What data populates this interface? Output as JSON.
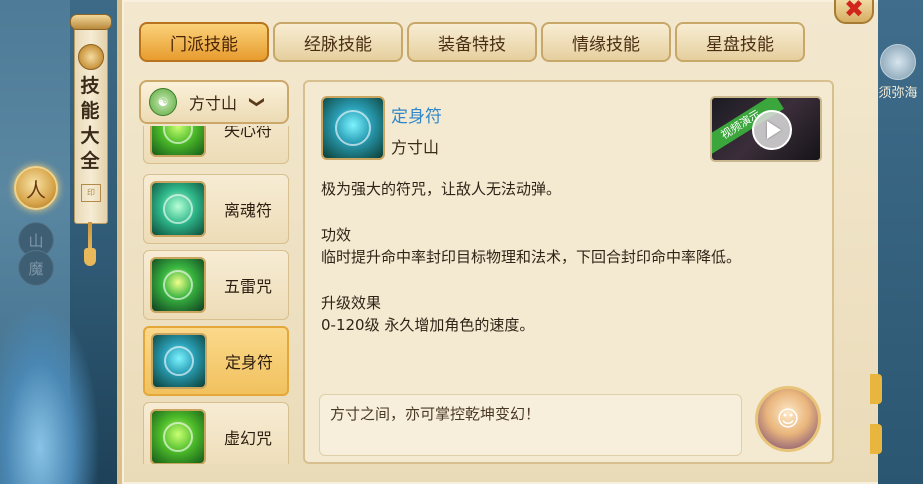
{
  "side_nav": {
    "chars": [
      "人",
      "山",
      "魔"
    ]
  },
  "scroll": {
    "title": "技能大全",
    "seal": "印"
  },
  "close": {
    "label": "✖"
  },
  "tabs": [
    {
      "label": "门派技能",
      "active": true
    },
    {
      "label": "经脉技能",
      "active": false
    },
    {
      "label": "装备特技",
      "active": false
    },
    {
      "label": "情缘技能",
      "active": false
    },
    {
      "label": "星盘技能",
      "active": false
    }
  ],
  "faction_select": {
    "value": "方寸山",
    "chevron": "❯"
  },
  "skills": [
    {
      "name": "失心符",
      "icon": "lost-heart-talisman-icon"
    },
    {
      "name": "离魂符",
      "icon": "soul-parting-talisman-icon"
    },
    {
      "name": "五雷咒",
      "icon": "five-thunder-curse-icon"
    },
    {
      "name": "定身符",
      "icon": "immobilize-talisman-icon",
      "selected": true
    },
    {
      "name": "虚幻咒",
      "icon": "illusion-curse-icon"
    }
  ],
  "detail": {
    "name": "定身符",
    "faction": "方寸山",
    "video_label": "视频演示",
    "description": "极为强大的符咒，让敌人无法动弹。",
    "effect_title": "功效",
    "effect_text": "临时提升命中率封印目标物理和法术，下回合封印命中率降低。",
    "upgrade_title": "升级效果",
    "upgrade_text": "0-120级 永久增加角色的速度。",
    "quote": "方寸之间，亦可掌控乾坤变幻！"
  },
  "right_panel": {
    "label": "须弥海"
  },
  "colors": {
    "accent": "#e79c2e",
    "skill_name": "#2f86c9",
    "close": "#d0261c"
  }
}
